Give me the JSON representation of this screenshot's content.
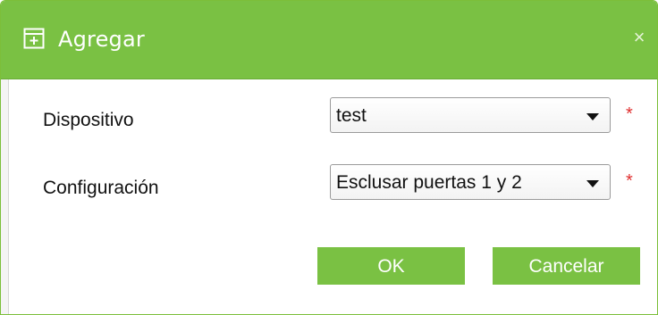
{
  "dialog": {
    "title": "Agregar",
    "close_symbol": "×",
    "title_icon": "add-document-icon",
    "accent_color": "#7ac143"
  },
  "form": {
    "device": {
      "label": "Dispositivo",
      "value": "test",
      "required_marker": "*"
    },
    "configuration": {
      "label": "Configuración",
      "value": "Esclusar puertas 1 y 2",
      "required_marker": "*"
    }
  },
  "buttons": {
    "ok": "OK",
    "cancel": "Cancelar"
  }
}
